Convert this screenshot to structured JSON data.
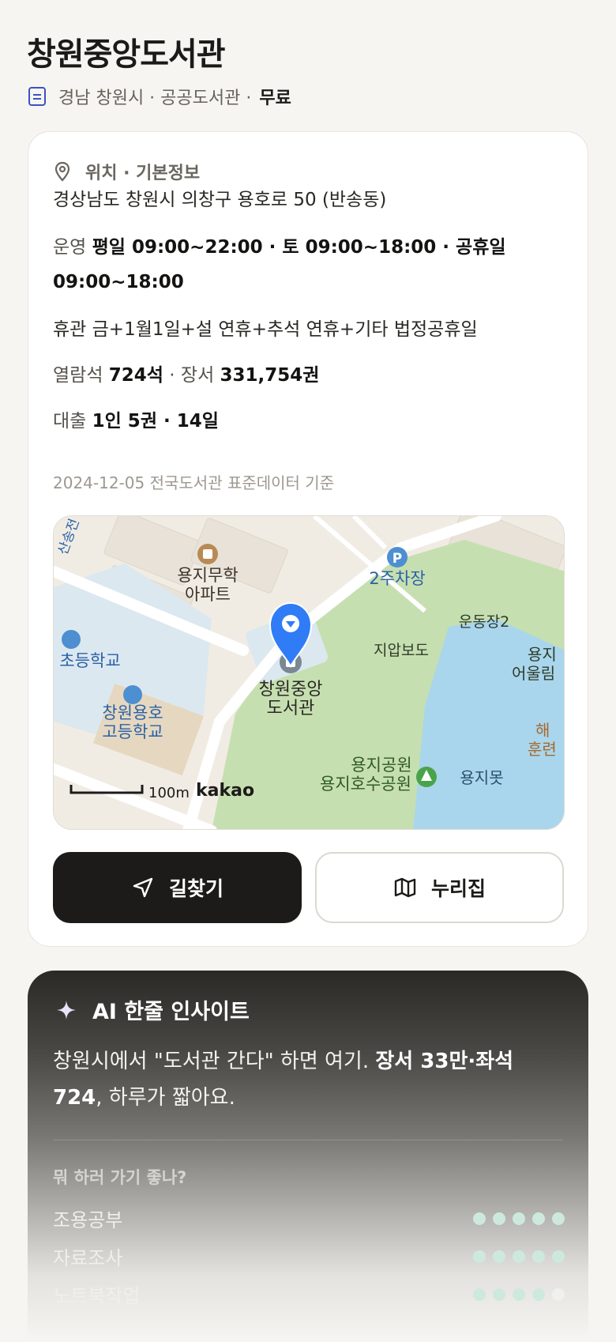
{
  "header": {
    "title": "창원중앙도서관",
    "subtitle": "경남 창원시 · 공공도서관 ·",
    "price": "무료"
  },
  "info": {
    "section_label": "위치 · 기본정보",
    "address": "경상남도 창원시 의창구 용호로 50 (반송동)",
    "hours_prefix": "운영",
    "hours_line1": "평일 09:00~22:00 · 토 09:00~18:00 · 공휴일",
    "hours_line2": "09:00~18:00",
    "closed": "휴관 금+1월1일+설 연휴+추석 연휴+기타 법정공휴일",
    "seats_prefix": "열람석",
    "seats_value": "724석",
    "books_sep": "· 장서",
    "books_value": "331,754권",
    "loan_prefix": "대출",
    "loan_value": "1인 5권 · 14일",
    "data_date": "2024-12-05 전국도서관 표준데이터 기준"
  },
  "map": {
    "labels": {
      "apartment": "용지무학\n아파트",
      "apt_line1": "용지무학",
      "apt_line2": "아파트",
      "parking": "2주차장",
      "field": "운동장2",
      "underpass": "지압보도",
      "elementary": "초등학교",
      "library_line1": "창원중앙",
      "library_line2": "도서관",
      "highschool_line1": "창원용호",
      "highschool_line2": "고등학교",
      "park": "용지공원",
      "lake_park": "용지호수공원",
      "pond": "용지못",
      "edge1": "용지",
      "edge2": "어울림",
      "edge3": "해",
      "edge4": "훈련",
      "road": "산송전",
      "scale": "100m",
      "brand": "kakao"
    },
    "colors": {
      "park": "#c6dfb0",
      "water": "#a9d6ec",
      "land": "#f1ece3",
      "pin": "#2f7cf6"
    }
  },
  "buttons": {
    "directions": "길찾기",
    "website": "누리집"
  },
  "ai": {
    "title": "AI 한줄 인사이트",
    "text_plain1": "창원시에서 \"도서관 간다\" 하면 여기. ",
    "text_bold": "장서 33만·좌석 724",
    "text_plain2": ", 하루가 짧아요.",
    "question": "뭐 하러 가기 좋나?",
    "activities": [
      {
        "label": "조용공부",
        "score": 5
      },
      {
        "label": "자료조사",
        "score": 5
      },
      {
        "label": "노트북작업",
        "score": 4
      }
    ]
  }
}
